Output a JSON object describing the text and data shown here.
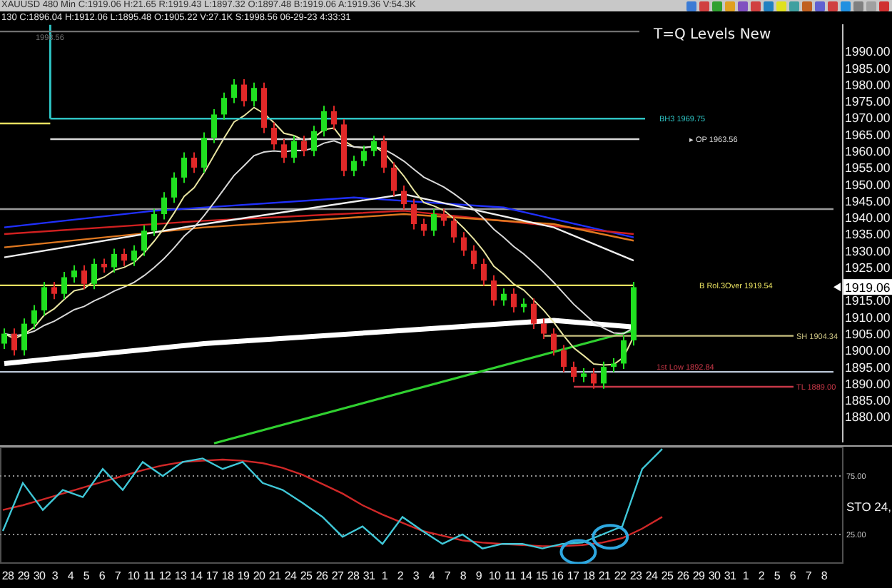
{
  "header": {
    "quote_line": "XAUUSD 480 Min C:1919.06 H:21.65 R:1919.43 L:1897.32 O:1897.48 B:1919.06 A:1919.36 V:54.3K",
    "bar_line": "130 C:1896.04 H:1912.06 L:1895.48 O:1905.22 V:27.1K S:1998.56 06-29-23 4:33:31"
  },
  "price_panel": {
    "title": "T=Q Levels New",
    "price_axis": [
      "1990.00",
      "1985.00",
      "1980.00",
      "1975.00",
      "1970.00",
      "1965.00",
      "1960.00",
      "1955.00",
      "1950.00",
      "1945.00",
      "1940.00",
      "1935.00",
      "1930.00",
      "1925.00",
      "1915.00",
      "1910.00",
      "1905.00",
      "1900.00",
      "1895.00",
      "1890.00",
      "1885.00",
      "1880.00"
    ],
    "levels": [
      {
        "label": "1998.56",
        "color": "#707070"
      },
      {
        "label": "BH3 1969.75",
        "color": "#2ec4c4"
      },
      {
        "label": "▸ OP 1963.56",
        "color": "#d8d8d8"
      },
      {
        "label": "B Rol.3Over 1919.54",
        "color": "#e8e060"
      },
      {
        "label": "SH 1904.34",
        "color": "#c8c080"
      },
      {
        "label": "1st Low 1892.84",
        "color": "#c83848"
      },
      {
        "label": "TL 1889.00",
        "color": "#c83848"
      }
    ],
    "current_price": "1919.06"
  },
  "stochastic_panel": {
    "label": "STO 24,",
    "chart_data": {
      "type": "line",
      "ylim": [
        0,
        100
      ],
      "yticks": [
        {
          "value": 75,
          "label": "75.00"
        },
        {
          "value": 25,
          "label": "25.00"
        }
      ],
      "series": [
        {
          "color": "#40c8d8",
          "values": [
            28,
            69,
            46,
            63,
            57,
            81,
            63,
            87,
            75,
            87,
            90,
            81,
            87,
            69,
            63,
            52,
            40,
            23,
            32,
            17,
            40,
            28,
            17,
            25,
            13,
            17,
            17,
            13,
            17,
            18,
            25,
            32,
            81,
            98
          ]
        },
        {
          "color": "#d02828",
          "values": [
            46,
            50,
            55,
            60,
            65,
            70,
            75,
            80,
            84,
            87,
            88,
            89,
            88,
            86,
            82,
            76,
            68,
            60,
            50,
            42,
            35,
            28,
            24,
            20,
            18,
            17,
            16,
            15,
            15,
            16,
            18,
            22,
            30,
            40
          ]
        }
      ]
    }
  },
  "time_axis": {
    "labels": [
      "28",
      "29",
      "30",
      "3",
      "4",
      "5",
      "6",
      "7",
      "10",
      "11",
      "12",
      "13",
      "14",
      "17",
      "18",
      "19",
      "20",
      "21",
      "24",
      "25",
      "26",
      "27",
      "28",
      "31",
      "1",
      "2",
      "3",
      "4",
      "7",
      "8",
      "9",
      "10",
      "11",
      "14",
      "15",
      "16",
      "17",
      "18",
      "21",
      "22",
      "23",
      "24",
      "25",
      "26",
      "29",
      "30",
      "31",
      "1",
      "2",
      "5",
      "6",
      "7",
      "8"
    ]
  }
}
